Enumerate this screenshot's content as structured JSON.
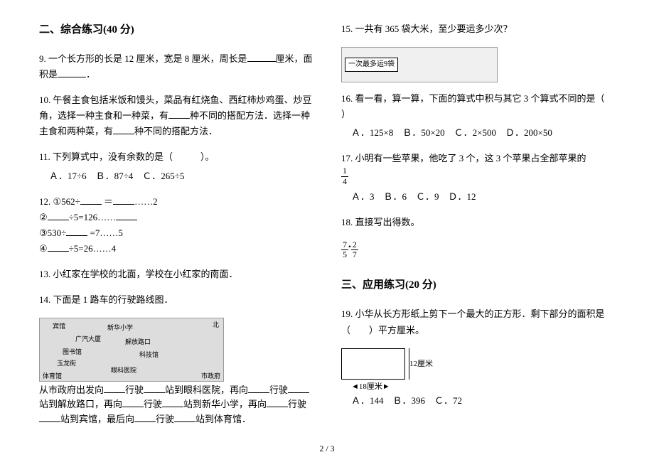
{
  "section2": {
    "title": "二、综合练习(40 分)",
    "q9": "9.  一个长方形的长是 12 厘米，宽是 8 厘米，周长是",
    "q9b": "厘米，面积是",
    "q9c": "．",
    "q10": "10.  午餐主食包括米饭和馒头，菜品有红烧鱼、西红柿炒鸡蛋、炒豆角，选择一种主食和一种菜，有",
    "q10b": "种不同的搭配方法．选择一种主食和两种菜，有",
    "q10c": "种不同的搭配方法．",
    "q11": "11.  下列算式中，没有余数的是（　　　）。",
    "q11opts": "Ａ．17÷6　Ｂ．87÷4　Ｃ．265÷5",
    "q12": "12.  ①562÷",
    "q12a": " ＝",
    "q12b": "……2",
    "q12line2a": "②",
    "q12line2b": "÷5=126……",
    "q12line3": "③530÷",
    "q12line3b": " =7……5",
    "q12line4": "④",
    "q12line4b": "÷5=26……4",
    "q13": "13.  小红家在学校的北面，学校在小红家的南面．",
    "q14": "14.  下面是 1 路车的行驶路线图．",
    "q14text": "从市政府出发向",
    "q14text2": "行驶",
    "q14text3": "站到眼科医院，再向",
    "q14text4": "行驶",
    "q14text5": "站到解放路口，再向",
    "q14text6": "行驶",
    "q14text7": "站到新华小学，再向",
    "q14text8": "行驶",
    "q14text9": "站到宾馆，最后向",
    "q14text10": "行驶",
    "q14text11": "站到体育馆．",
    "map": {
      "binguan": "宾馆",
      "xinhua": "新华小学",
      "guangqi": "广汽大厦",
      "jiefang": "解放路口",
      "tushuguan": "图书馆",
      "keji": "科技馆",
      "yulong": "玉龙街",
      "yanke": "眼科医院",
      "tiyu": "体育馆",
      "shizheng": "市政府",
      "bei": "北"
    }
  },
  "right": {
    "q15": "15.  一共有 365 袋大米，至少要运多少次？",
    "truck_label": "一次最多运9袋",
    "q16": "16.  看一看，算一算，下面的算式中积与其它 3 个算式不同的是（　　 ）",
    "q16opts": "Ａ．125×8　Ｂ．50×20　Ｃ．2×500　Ｄ．200×50",
    "q17a": "17.  小明有一些苹果，他吃了 3 个，这 3 个苹果占全部苹果的",
    "q17frac_num": "1",
    "q17frac_den": "4",
    "q17opts": "Ａ．3　Ｂ．6　Ｃ．9　Ｄ．12",
    "q18": "18.  直接写出得数。",
    "q18expr_a": "7",
    "q18expr_b": "5",
    "q18expr_c": "2",
    "q18expr_d": "7"
  },
  "section3": {
    "title": "三、应用练习(20 分)",
    "q19": "19.  小华从长方形纸上剪下一个最大的正方形．剩下部分的面积是（　　）平方厘米。",
    "dim_h": "12厘米",
    "dim_w": "18厘米",
    "q19opts": "Ａ．144　Ｂ．396　Ｃ．72"
  },
  "page": "2 / 3"
}
